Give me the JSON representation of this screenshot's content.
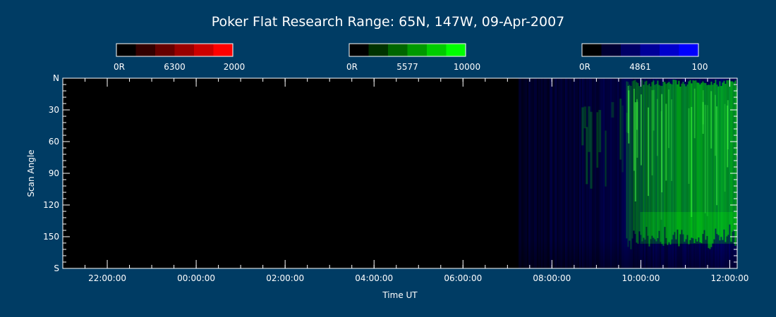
{
  "chart_data": {
    "type": "heatmap",
    "title": "Poker Flat Research Range: 65N, 147W, 09-Apr-2007",
    "xlabel": "Time UT",
    "ylabel": "Scan Angle",
    "x_range": [
      "21:00:00",
      "12:10:00"
    ],
    "x_ticks": [
      "22:00:00",
      "00:00:00",
      "02:00:00",
      "04:00:00",
      "06:00:00",
      "08:00:00",
      "10:00:00",
      "12:00:00"
    ],
    "y_range": [
      0,
      180
    ],
    "y_ticks": [
      "N",
      "30",
      "60",
      "90",
      "120",
      "150",
      "S"
    ],
    "colorbars": [
      {
        "wavelength": "6300",
        "min_label": "0R",
        "max_label": "2000",
        "color": "#ff0000"
      },
      {
        "wavelength": "5577",
        "min_label": "0R",
        "max_label": "10000",
        "color": "#00ff00"
      },
      {
        "wavelength": "4861",
        "min_label": "0R",
        "max_label": "100",
        "color": "#0000ff"
      }
    ],
    "background_color": "#003c64",
    "plot_background": "#000000",
    "emission_regions": [
      {
        "channel": "4861",
        "start": "07:15:00",
        "end": "12:10:00",
        "level": "weak"
      },
      {
        "channel": "5577",
        "start": "08:40:00",
        "end": "09:40:00",
        "level": "weak"
      },
      {
        "channel": "5577",
        "start": "09:40:00",
        "end": "12:10:00",
        "level": "strong"
      }
    ]
  }
}
